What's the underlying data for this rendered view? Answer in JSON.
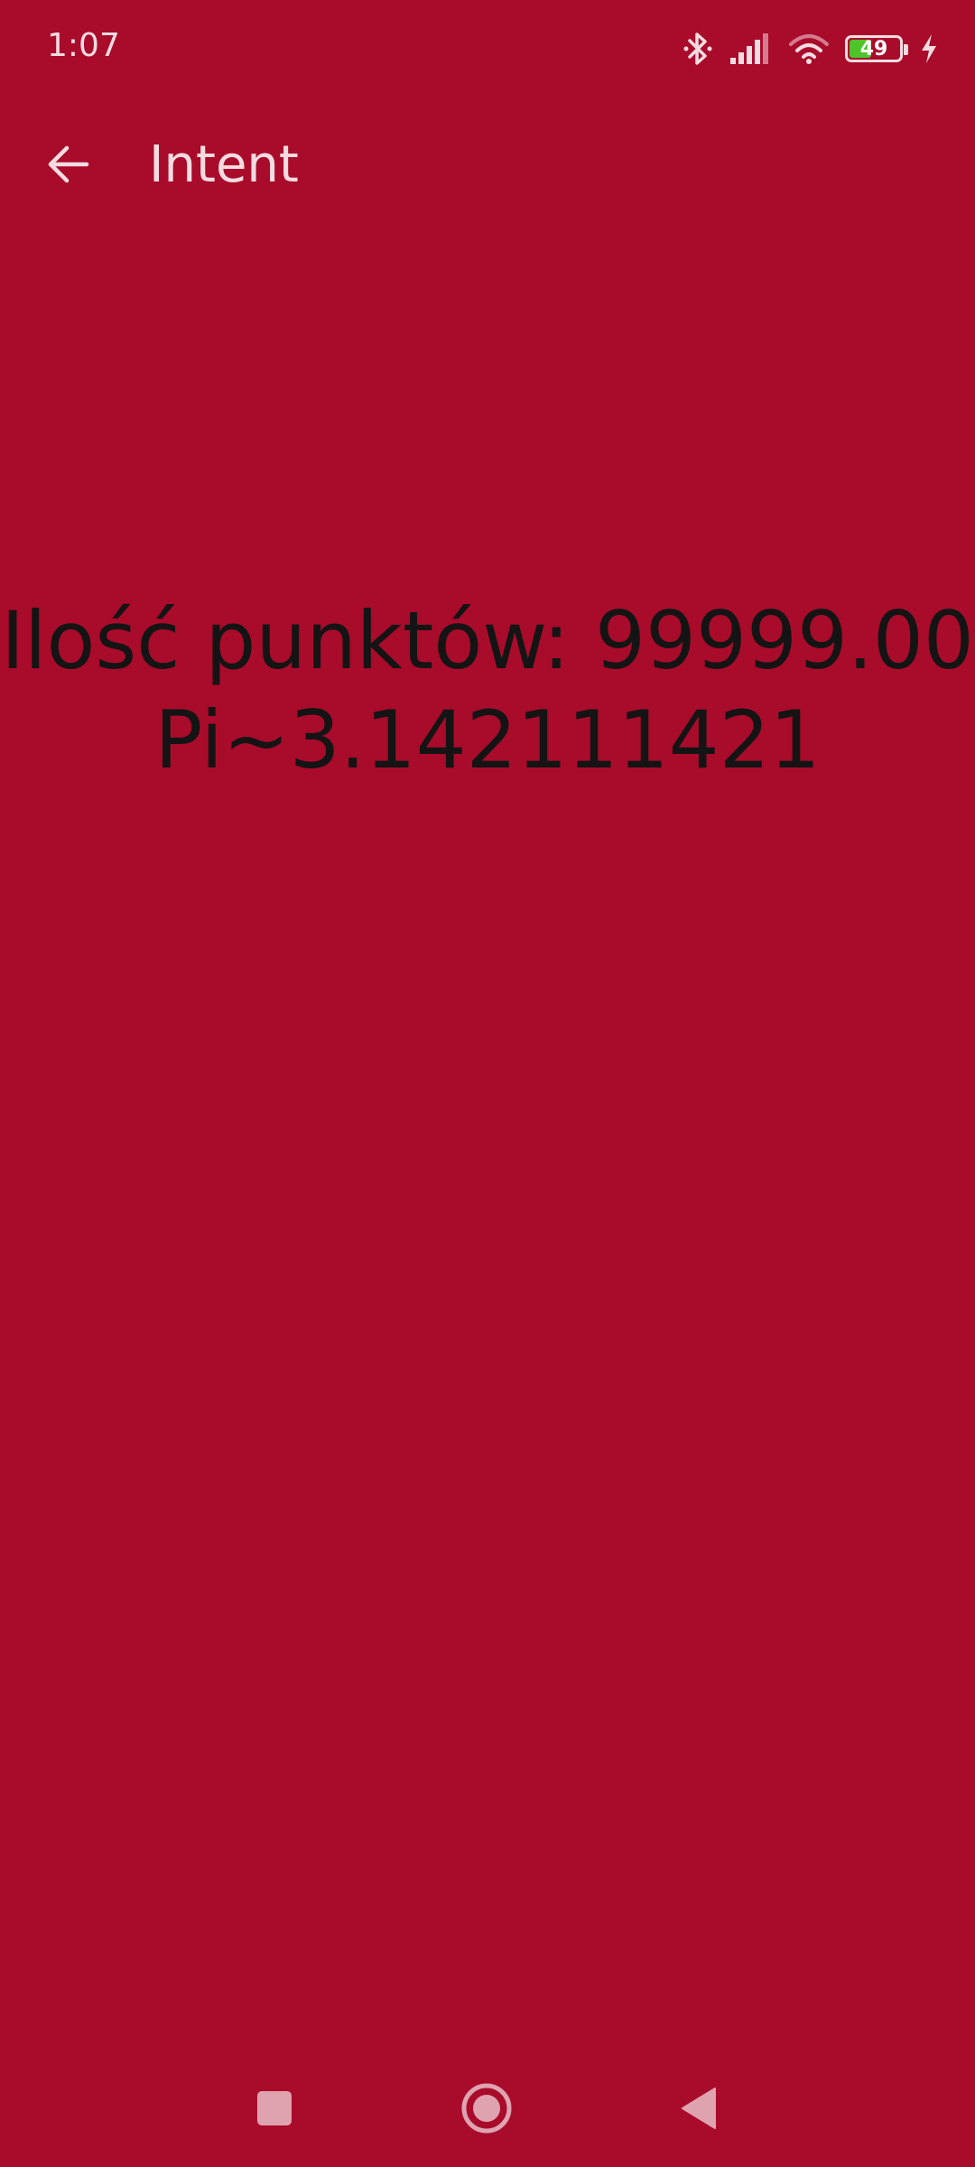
{
  "status_bar": {
    "time": "1:07",
    "battery_level": "49",
    "battery_fraction": 0.49,
    "icons": [
      "bluetooth-icon",
      "signal-icon",
      "wifi-icon",
      "battery-icon",
      "charging-icon"
    ]
  },
  "app_bar": {
    "title": "Intent",
    "back_icon": "arrow-left-icon"
  },
  "main": {
    "points_line": "Ilość punktów: 99999.00",
    "pi_line": "Pi~3.142111421"
  },
  "nav_bar": {
    "icons": [
      "recents-square-icon",
      "home-circle-icon",
      "back-triangle-icon"
    ]
  },
  "colors": {
    "background": "#a90b2b",
    "text_dark": "#141414",
    "text_light": "#f3dce1",
    "battery_fill": "#4cc42a"
  }
}
